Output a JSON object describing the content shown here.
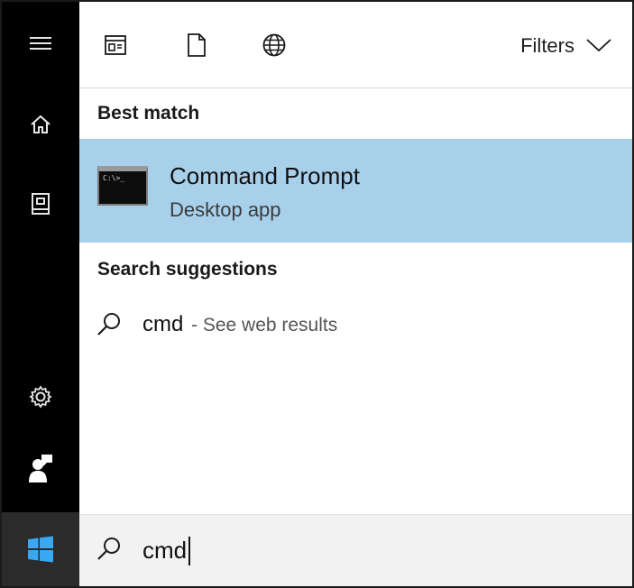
{
  "toolbar": {
    "filters_label": "Filters",
    "icons": [
      "apps-icon",
      "document-icon",
      "web-globe-icon",
      "chevron-down-icon"
    ]
  },
  "best_match": {
    "heading": "Best match",
    "item": {
      "title": "Command Prompt",
      "subtitle": "Desktop app",
      "icon": "command-prompt-icon"
    }
  },
  "search_suggestions": {
    "heading": "Search suggestions",
    "items": [
      {
        "term": "cmd",
        "note": "- See web results"
      }
    ]
  },
  "rail": {
    "icons": [
      "hamburger-menu-icon",
      "home-icon",
      "notebook-icon",
      "settings-gear-icon",
      "feedback-icon",
      "windows-start-icon"
    ]
  },
  "search": {
    "value": "cmd",
    "placeholder": ""
  },
  "colors": {
    "rail": "#000000",
    "highlight": "#a9d0ea",
    "searchbar": "#f2f2f2",
    "start_button": "#2b2b2b"
  }
}
